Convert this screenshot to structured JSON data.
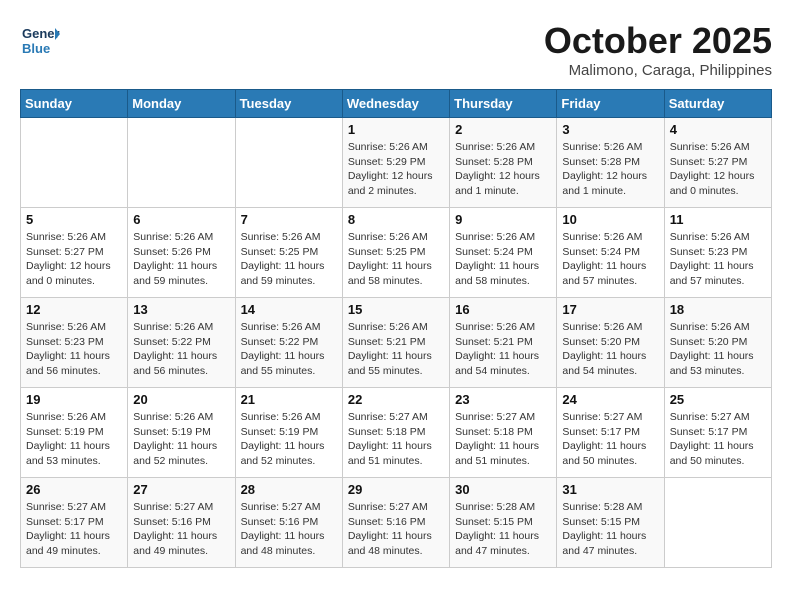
{
  "header": {
    "logo_line1": "General",
    "logo_line2": "Blue",
    "month_title": "October 2025",
    "subtitle": "Malimono, Caraga, Philippines"
  },
  "calendar": {
    "days_of_week": [
      "Sunday",
      "Monday",
      "Tuesday",
      "Wednesday",
      "Thursday",
      "Friday",
      "Saturday"
    ],
    "weeks": [
      [
        {
          "day": "",
          "info": ""
        },
        {
          "day": "",
          "info": ""
        },
        {
          "day": "",
          "info": ""
        },
        {
          "day": "1",
          "info": "Sunrise: 5:26 AM\nSunset: 5:29 PM\nDaylight: 12 hours\nand 2 minutes."
        },
        {
          "day": "2",
          "info": "Sunrise: 5:26 AM\nSunset: 5:28 PM\nDaylight: 12 hours\nand 1 minute."
        },
        {
          "day": "3",
          "info": "Sunrise: 5:26 AM\nSunset: 5:28 PM\nDaylight: 12 hours\nand 1 minute."
        },
        {
          "day": "4",
          "info": "Sunrise: 5:26 AM\nSunset: 5:27 PM\nDaylight: 12 hours\nand 0 minutes."
        }
      ],
      [
        {
          "day": "5",
          "info": "Sunrise: 5:26 AM\nSunset: 5:27 PM\nDaylight: 12 hours\nand 0 minutes."
        },
        {
          "day": "6",
          "info": "Sunrise: 5:26 AM\nSunset: 5:26 PM\nDaylight: 11 hours\nand 59 minutes."
        },
        {
          "day": "7",
          "info": "Sunrise: 5:26 AM\nSunset: 5:25 PM\nDaylight: 11 hours\nand 59 minutes."
        },
        {
          "day": "8",
          "info": "Sunrise: 5:26 AM\nSunset: 5:25 PM\nDaylight: 11 hours\nand 58 minutes."
        },
        {
          "day": "9",
          "info": "Sunrise: 5:26 AM\nSunset: 5:24 PM\nDaylight: 11 hours\nand 58 minutes."
        },
        {
          "day": "10",
          "info": "Sunrise: 5:26 AM\nSunset: 5:24 PM\nDaylight: 11 hours\nand 57 minutes."
        },
        {
          "day": "11",
          "info": "Sunrise: 5:26 AM\nSunset: 5:23 PM\nDaylight: 11 hours\nand 57 minutes."
        }
      ],
      [
        {
          "day": "12",
          "info": "Sunrise: 5:26 AM\nSunset: 5:23 PM\nDaylight: 11 hours\nand 56 minutes."
        },
        {
          "day": "13",
          "info": "Sunrise: 5:26 AM\nSunset: 5:22 PM\nDaylight: 11 hours\nand 56 minutes."
        },
        {
          "day": "14",
          "info": "Sunrise: 5:26 AM\nSunset: 5:22 PM\nDaylight: 11 hours\nand 55 minutes."
        },
        {
          "day": "15",
          "info": "Sunrise: 5:26 AM\nSunset: 5:21 PM\nDaylight: 11 hours\nand 55 minutes."
        },
        {
          "day": "16",
          "info": "Sunrise: 5:26 AM\nSunset: 5:21 PM\nDaylight: 11 hours\nand 54 minutes."
        },
        {
          "day": "17",
          "info": "Sunrise: 5:26 AM\nSunset: 5:20 PM\nDaylight: 11 hours\nand 54 minutes."
        },
        {
          "day": "18",
          "info": "Sunrise: 5:26 AM\nSunset: 5:20 PM\nDaylight: 11 hours\nand 53 minutes."
        }
      ],
      [
        {
          "day": "19",
          "info": "Sunrise: 5:26 AM\nSunset: 5:19 PM\nDaylight: 11 hours\nand 53 minutes."
        },
        {
          "day": "20",
          "info": "Sunrise: 5:26 AM\nSunset: 5:19 PM\nDaylight: 11 hours\nand 52 minutes."
        },
        {
          "day": "21",
          "info": "Sunrise: 5:26 AM\nSunset: 5:19 PM\nDaylight: 11 hours\nand 52 minutes."
        },
        {
          "day": "22",
          "info": "Sunrise: 5:27 AM\nSunset: 5:18 PM\nDaylight: 11 hours\nand 51 minutes."
        },
        {
          "day": "23",
          "info": "Sunrise: 5:27 AM\nSunset: 5:18 PM\nDaylight: 11 hours\nand 51 minutes."
        },
        {
          "day": "24",
          "info": "Sunrise: 5:27 AM\nSunset: 5:17 PM\nDaylight: 11 hours\nand 50 minutes."
        },
        {
          "day": "25",
          "info": "Sunrise: 5:27 AM\nSunset: 5:17 PM\nDaylight: 11 hours\nand 50 minutes."
        }
      ],
      [
        {
          "day": "26",
          "info": "Sunrise: 5:27 AM\nSunset: 5:17 PM\nDaylight: 11 hours\nand 49 minutes."
        },
        {
          "day": "27",
          "info": "Sunrise: 5:27 AM\nSunset: 5:16 PM\nDaylight: 11 hours\nand 49 minutes."
        },
        {
          "day": "28",
          "info": "Sunrise: 5:27 AM\nSunset: 5:16 PM\nDaylight: 11 hours\nand 48 minutes."
        },
        {
          "day": "29",
          "info": "Sunrise: 5:27 AM\nSunset: 5:16 PM\nDaylight: 11 hours\nand 48 minutes."
        },
        {
          "day": "30",
          "info": "Sunrise: 5:28 AM\nSunset: 5:15 PM\nDaylight: 11 hours\nand 47 minutes."
        },
        {
          "day": "31",
          "info": "Sunrise: 5:28 AM\nSunset: 5:15 PM\nDaylight: 11 hours\nand 47 minutes."
        },
        {
          "day": "",
          "info": ""
        }
      ]
    ]
  }
}
